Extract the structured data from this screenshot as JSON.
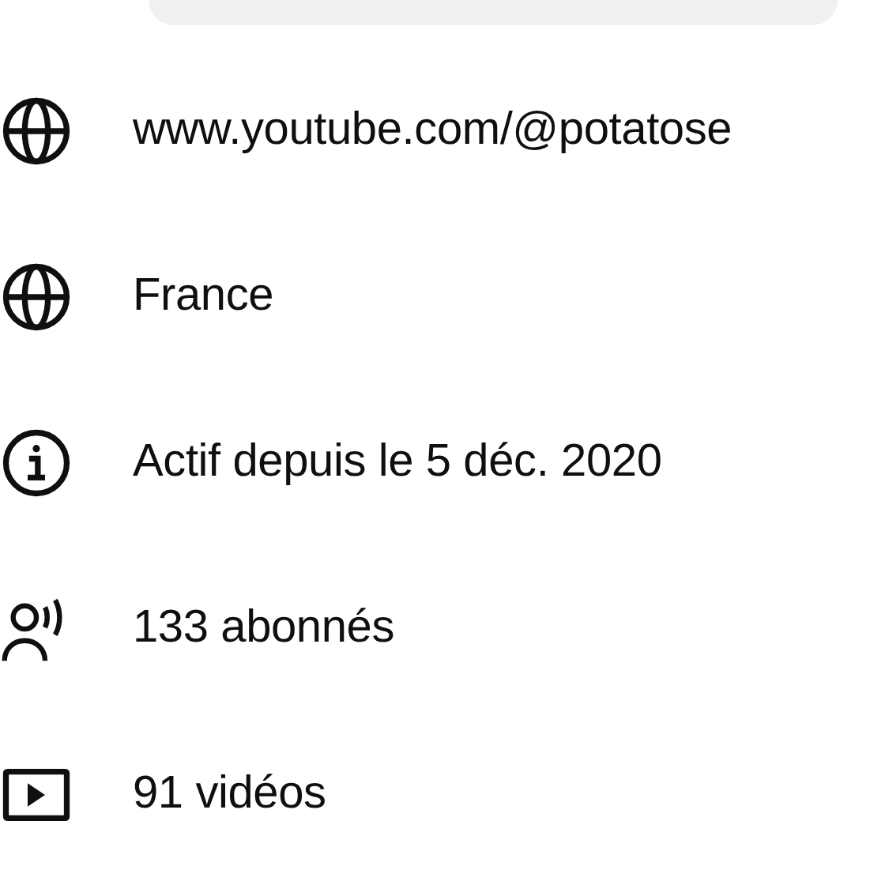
{
  "details": [
    {
      "kind": "globe",
      "text": "www.youtube.com/@potatose"
    },
    {
      "kind": "globe",
      "text": "France"
    },
    {
      "kind": "info",
      "text": "Actif depuis le 5 déc. 2020"
    },
    {
      "kind": "subscribers",
      "text": "133 abonnés"
    },
    {
      "kind": "video",
      "text": "91 vidéos"
    }
  ]
}
